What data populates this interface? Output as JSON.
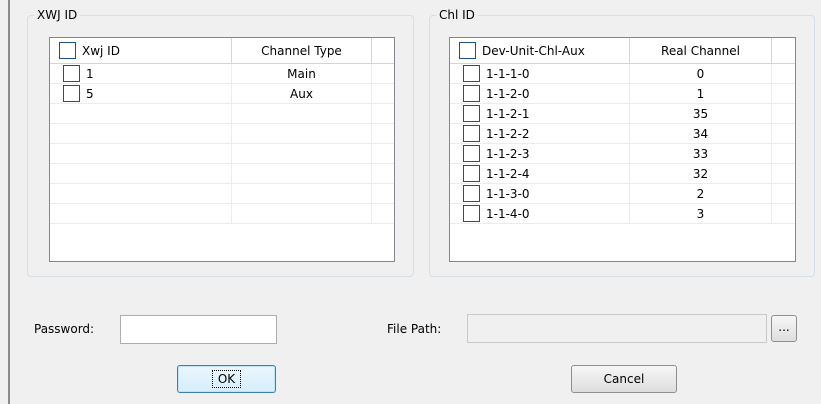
{
  "xwj_group": {
    "legend": "XWJ ID",
    "headers": [
      "Xwj ID",
      "Channel Type"
    ],
    "rows": [
      {
        "id": "1",
        "type": "Main"
      },
      {
        "id": "5",
        "type": "Aux"
      }
    ],
    "empty_rows": 6
  },
  "chl_group": {
    "legend": "Chl ID",
    "headers": [
      "Dev-Unit-Chl-Aux",
      "Real Channel"
    ],
    "rows": [
      {
        "id": "1-1-1-0",
        "real": "0"
      },
      {
        "id": "1-1-2-0",
        "real": "1"
      },
      {
        "id": "1-1-2-1",
        "real": "35"
      },
      {
        "id": "1-1-2-2",
        "real": "34"
      },
      {
        "id": "1-1-2-3",
        "real": "33"
      },
      {
        "id": "1-1-2-4",
        "real": "32"
      },
      {
        "id": "1-1-3-0",
        "real": "2"
      },
      {
        "id": "1-1-4-0",
        "real": "3"
      }
    ]
  },
  "form": {
    "password_label": "Password:",
    "password_value": "",
    "filepath_label": "File Path:",
    "filepath_value": "",
    "browse_label": "...",
    "ok_label": "OK",
    "cancel_label": "Cancel"
  }
}
